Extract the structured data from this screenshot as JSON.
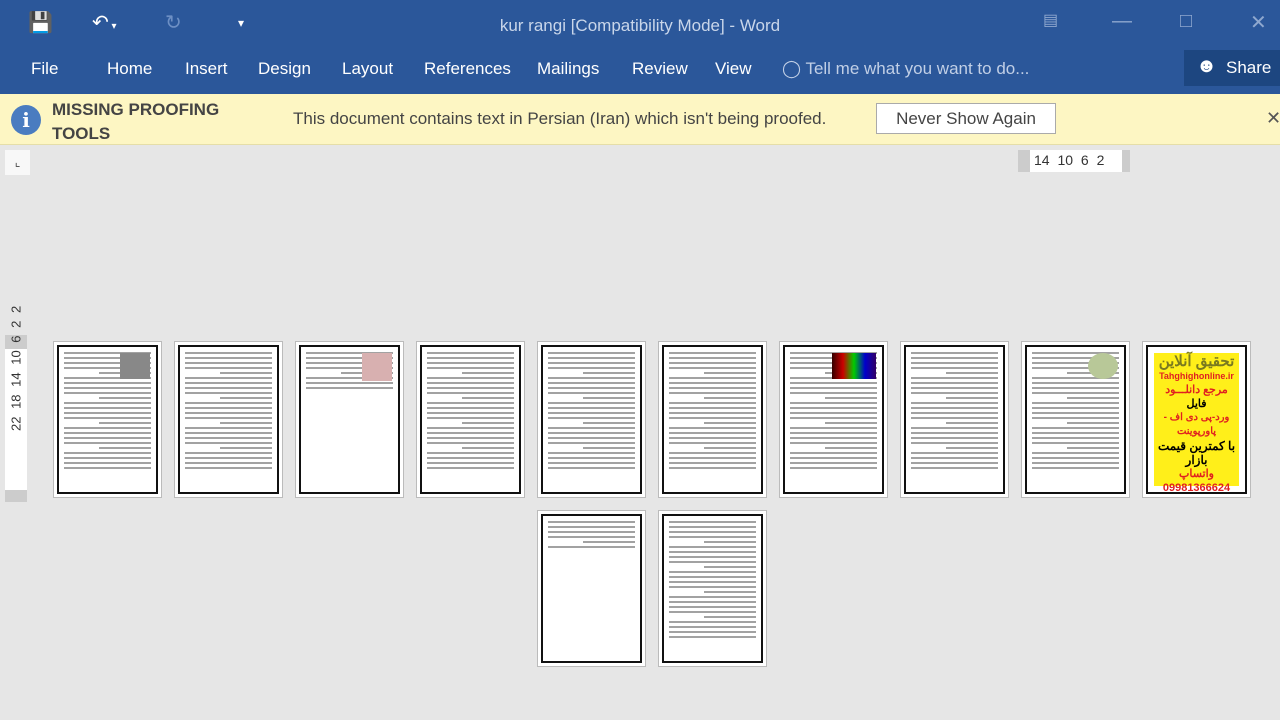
{
  "window": {
    "title": "kur rangi [Compatibility Mode] - Word"
  },
  "qat": {
    "save": "save-icon",
    "undo": "undo-icon",
    "redo": "redo-icon",
    "customize": "customize-icon"
  },
  "ribbon": {
    "tabs": [
      "File",
      "Home",
      "Insert",
      "Design",
      "Layout",
      "References",
      "Mailings",
      "Review",
      "View"
    ],
    "tell_me": "Tell me what you want to do...",
    "share": "Share"
  },
  "infobar": {
    "title": "MISSING PROOFING TOOLS",
    "message": "This document contains text in Persian (Iran) which isn't being proofed.",
    "button": "Never Show Again"
  },
  "ruler": {
    "horizontal": "14 10 6 2",
    "vertical": "22 18 14 10 6 2 2"
  },
  "ad_page": {
    "line1": "تحقیق آنلاین",
    "site": "Tahghighonline.ir",
    "line2": "مرجع دانلـــود",
    "line3": "فایل",
    "line4": "ورد-پی دی اف - پاورپوینت",
    "line5": "با کمترین قیمت بازار",
    "phone": "09981366624",
    "line6": "واتساپ"
  },
  "colors": {
    "ribbon": "#2b579a",
    "infobar": "#fdf6c3",
    "accent": "#4a7cc0"
  }
}
